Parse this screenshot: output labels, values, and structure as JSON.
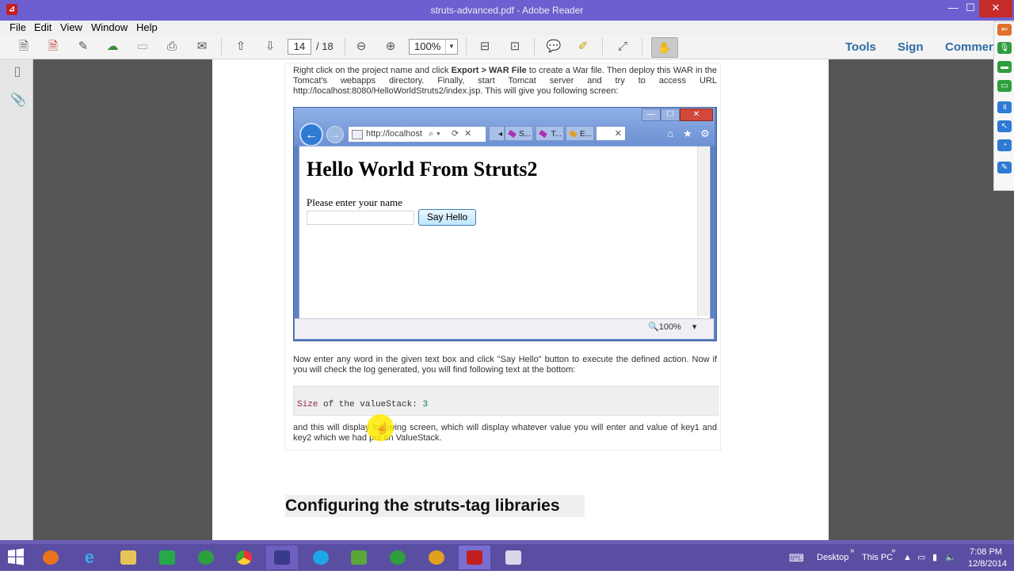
{
  "window": {
    "title": "struts-advanced.pdf - Adobe Reader",
    "app_icon": "adobe-reader-icon",
    "controls": [
      "minimize-icon",
      "maximize-icon",
      "close-icon"
    ]
  },
  "menubar": {
    "items": [
      "File",
      "Edit",
      "View",
      "Window",
      "Help"
    ]
  },
  "toolbar": {
    "page_current": "14",
    "page_total": "/ 18",
    "zoom": "100%",
    "tools_label": "Tools",
    "sign_label": "Sign",
    "comment_label": "Commen",
    "icons": [
      "create-pdf-icon",
      "export-pdf-icon",
      "edit-icon",
      "cloud-upload-icon",
      "save-icon",
      "print-icon",
      "email-icon",
      "page-up-icon",
      "page-down-icon",
      "zoom-out-icon",
      "zoom-in-icon",
      "fit-page-icon",
      "fit-width-icon",
      "comment-icon",
      "highlight-icon",
      "full-screen-icon",
      "hand-tool-icon"
    ]
  },
  "leftnav": {
    "icons": [
      "page-thumbnails-icon",
      "attachments-icon"
    ]
  },
  "document": {
    "para1": "Right click on the project name and click Export > WAR File to create a War file. Then deploy this WAR in the Tomcat's webapps directory. Finally, start Tomcat server and try to access URL http://localhost:8080/HelloWorldStruts2/index.jsp. This will give you following screen:",
    "para1_start": "Right click on the project name and click ",
    "para1_bold": "Export > WAR File",
    "para1_end": " to create a War file. Then deploy this WAR in the Tomcat's webapps directory. Finally, start Tomcat server and try to access URL http://localhost:8080/HelloWorldStruts2/index.jsp. This will give you following screen:",
    "para2": "Now enter any word in the given text box and click \"Say Hello\" button to execute the defined action. Now if you will check the log generated, you will find following text at the bottom:",
    "code_kw": "Size",
    "code_mid": " of the valueStack: ",
    "code_num": "3",
    "para3": "and this will display following screen, which will display whatever value you will enter and value of key1 and key2 which we had put on ValueStack.",
    "section_heading": "Configuring the struts-tag libraries"
  },
  "embedded_browser": {
    "address": "http://localhost",
    "tabs": [
      "S...",
      "T...",
      "E..."
    ],
    "page_title": "Hello World From Struts2",
    "prompt": "Please enter your name",
    "button_label": "Say Hello",
    "zoom_status": "100%",
    "status_icons": [
      "zoom-icon",
      "dropdown-arrow-icon"
    ]
  },
  "taskbar": {
    "apps": [
      "firefox-icon",
      "internet-explorer-icon",
      "file-explorer-icon",
      "calculator-icon",
      "green-app-icon",
      "chrome-icon",
      "visual-studio-icon",
      "skype-icon",
      "image-app-icon",
      "green-app-2-icon",
      "settings-app-icon",
      "adobe-reader-icon",
      "media-app-icon"
    ],
    "desktop_label": "Desktop",
    "thispc_label": "This PC",
    "time": "7:08 PM",
    "date": "12/8/2014"
  },
  "colors": {
    "accent_titlebar": "#6e5fd0",
    "close_button": "#c62b2b",
    "taskbar": "#5a4ea3",
    "tools_text": "#2e6ca4",
    "doc_background": "#565656"
  }
}
